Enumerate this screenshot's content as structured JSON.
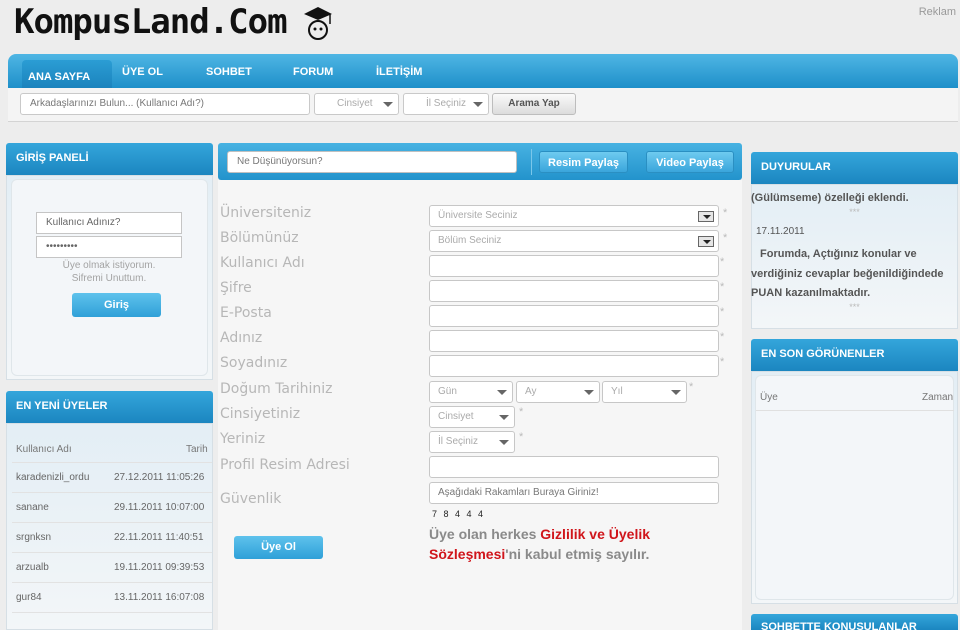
{
  "header": {
    "logo_text": "KompusLand.Com",
    "reklam": "Reklam"
  },
  "nav": {
    "items": [
      "ANA SAYFA",
      "ÜYE OL",
      "SOHBET",
      "FORUM",
      "İLETİŞİM"
    ]
  },
  "search": {
    "friend_placeholder": "Arkadaşlarınızı Bulun... (Kullanıcı Adı?)",
    "gender_select": "Cinsiyet",
    "city_select": "İl Seçiniz",
    "search_button": "Arama Yap"
  },
  "login": {
    "title": "GİRİŞ PANELİ",
    "username_placeholder": "Kullanıcı Adınız?",
    "password_value": "•••••••••",
    "register_link": "Üye olmak istiyorum.",
    "forgot_link": "Sifremi Unuttum.",
    "login_button": "Giriş"
  },
  "new_members": {
    "title": "EN YENİ ÜYELER",
    "col_user": "Kullanıcı Adı",
    "col_date": "Tarih",
    "rows": [
      {
        "user": "karadenizli_ordu",
        "date": "27.12.2011 11:05:26"
      },
      {
        "user": "sanane",
        "date": "29.11.2011 10:07:00"
      },
      {
        "user": "srgnksn",
        "date": "22.11.2011 11:40:51"
      },
      {
        "user": "arzualb",
        "date": "19.11.2011 09:39:53"
      },
      {
        "user": "gur84",
        "date": "13.11.2011 16:07:08"
      }
    ]
  },
  "share": {
    "status_placeholder": "Ne Düşünüyorsun?",
    "photo_button": "Resim Paylaş",
    "video_button": "Video Paylaş"
  },
  "form": {
    "labels": {
      "university": "Üniversiteniz",
      "department": "Bölümünüz",
      "username": "Kullanıcı Adı",
      "password": "Şifre",
      "email": "E-Posta",
      "name": "Adınız",
      "surname": "Soyadınız",
      "birthdate": "Doğum Tarihiniz",
      "gender": "Cinsiyetiniz",
      "location": "Yeriniz",
      "profile_pic": "Profil Resim Adresi",
      "security": "Güvenlik"
    },
    "university_select": "Üniversite Seciniz",
    "department_select": "Bölüm Seciniz",
    "day_select": "Gün",
    "month_select": "Ay",
    "year_select": "Yıl",
    "gender_select": "Cinsiyet",
    "location_select": "İl Seçiniz",
    "security_placeholder": "Aşağıdaki Rakamları Buraya Giriniz!",
    "captcha": "7 8 4 4 4",
    "star": "*",
    "terms_prefix": "Üye olan herkes ",
    "terms_link1": "Gizlilik ve Üyelik",
    "terms_link2": "Sözleşmesi",
    "terms_suffix": "'ni kabul etmiş sayılır.",
    "submit_button": "Üye Ol"
  },
  "announcements": {
    "title": "DUYURULAR",
    "item1": "(Gülümseme) özelleği eklendi.",
    "sep1": "***",
    "date": "17.11.2011",
    "line1": "Forumda, Açtığınız konular ve",
    "line2": "verdiğiniz cevaplar beğenildiğindede",
    "line3": "PUAN kazanılmaktadır.",
    "sep2": "***"
  },
  "last_seen": {
    "title": "EN SON GÖRÜNENLER",
    "col_user": "Üye",
    "col_time": "Zaman"
  },
  "chat_topics": {
    "title": "SOHBETTE KONUŞULANLAR"
  },
  "colors": {
    "accent": "#1e8fc9",
    "link_red": "#d0151b"
  }
}
